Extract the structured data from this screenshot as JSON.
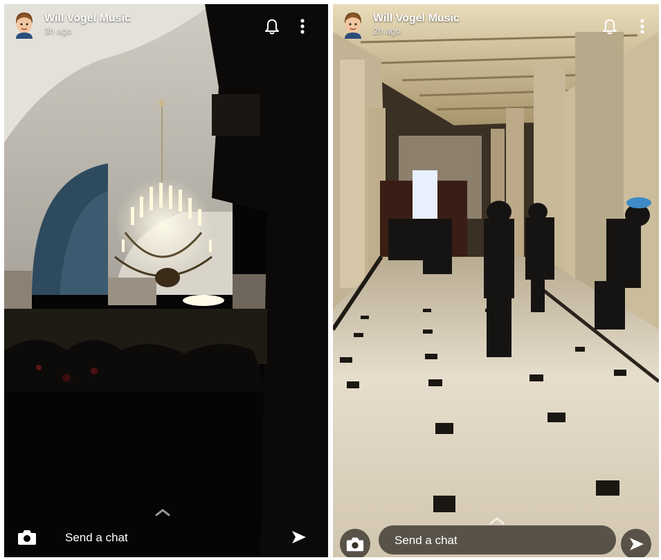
{
  "stories": [
    {
      "username": "Will Vogel Music",
      "timestamp": "3h ago",
      "chat_placeholder": "Send a chat",
      "icons": [
        "avatar",
        "bell-icon",
        "more-icon",
        "chevron-up-icon",
        "camera-icon",
        "send-icon"
      ]
    },
    {
      "username": "Will Vogel Music",
      "timestamp": "2h ago",
      "chat_placeholder": "Send a chat",
      "icons": [
        "avatar",
        "bell-icon",
        "more-icon",
        "chevron-up-icon",
        "camera-icon",
        "send-icon"
      ]
    }
  ],
  "colors": {
    "text": "#ffffff",
    "left_bg": "#050505",
    "right_floor": "#e6ddcc"
  }
}
